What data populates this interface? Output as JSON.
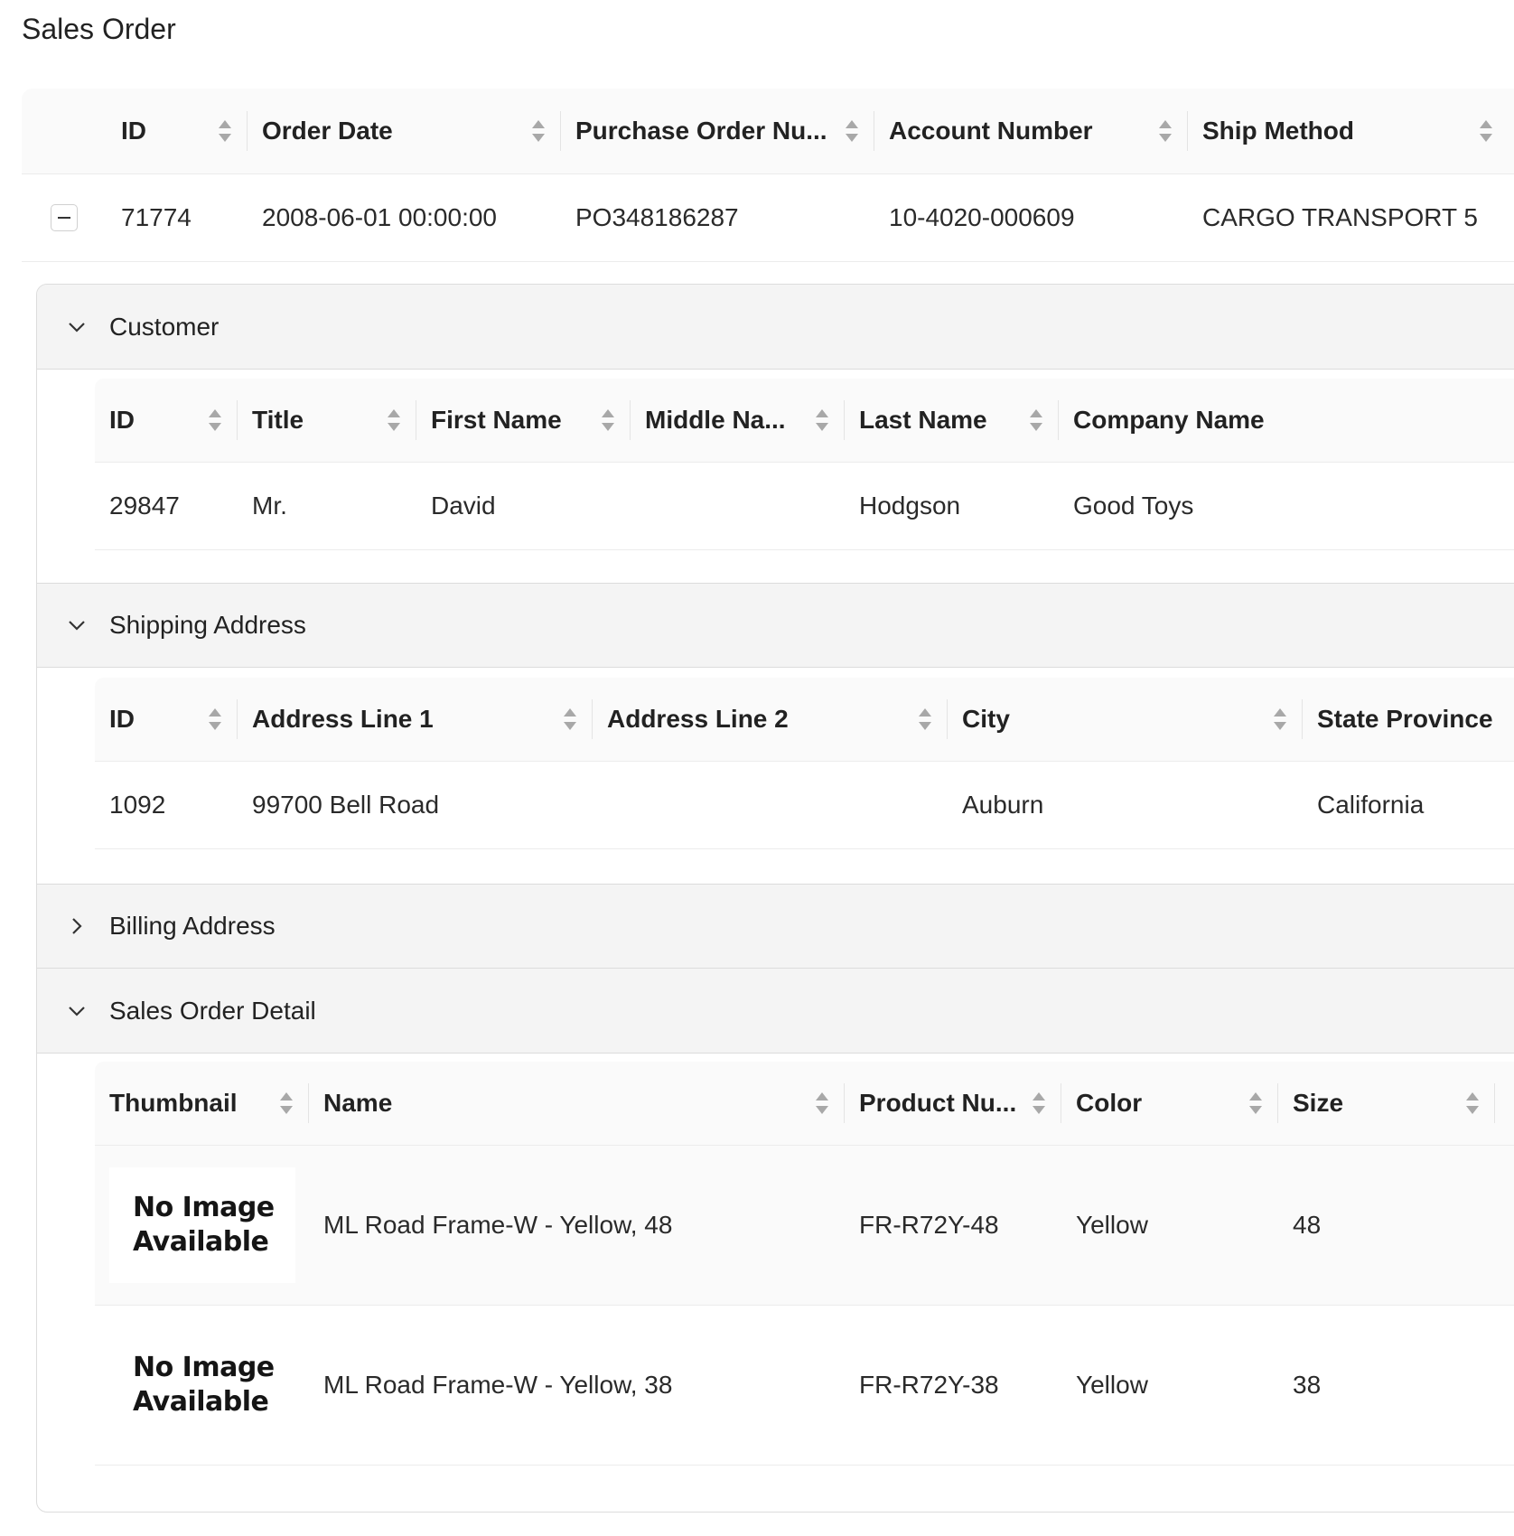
{
  "page": {
    "title": "Sales Order"
  },
  "orders": {
    "columns": [
      "ID",
      "Order Date",
      "Purchase Order Nu...",
      "Account Number",
      "Ship Method"
    ],
    "row": {
      "collapse_symbol": "−",
      "cells": [
        "71774",
        "2008-06-01 00:00:00",
        "PO348186287",
        "10-4020-000609",
        "CARGO TRANSPORT 5"
      ]
    }
  },
  "customer": {
    "title": "Customer",
    "columns": [
      "ID",
      "Title",
      "First Name",
      "Middle Na...",
      "Last Name",
      "Company Name"
    ],
    "row": [
      "29847",
      "Mr.",
      "David",
      "",
      "Hodgson",
      "Good Toys"
    ]
  },
  "shipping": {
    "title": "Shipping Address",
    "columns": [
      "ID",
      "Address Line 1",
      "Address Line 2",
      "City",
      "State Province"
    ],
    "row": [
      "1092",
      "99700 Bell Road",
      "",
      "Auburn",
      "California"
    ]
  },
  "billing": {
    "title": "Billing Address",
    "state": "collapsed"
  },
  "detail": {
    "title": "Sales Order Detail",
    "columns": [
      "Thumbnail",
      "Name",
      "Product Nu...",
      "Color",
      "Size"
    ],
    "rows": [
      {
        "thumb_line1": "No Image",
        "thumb_line2": "Available",
        "name": "ML Road Frame-W - Yellow, 48",
        "product": "FR-R72Y-48",
        "color": "Yellow",
        "size": "48"
      },
      {
        "thumb_line1": "No Image",
        "thumb_line2": "Available",
        "name": "ML Road Frame-W - Yellow, 38",
        "product": "FR-R72Y-38",
        "color": "Yellow",
        "size": "38"
      }
    ]
  },
  "colors": {
    "header_bg": "#fafafa",
    "section_bg": "#f4f4f4",
    "border": "#dcdcdc",
    "sorter": "#a8a8a8"
  },
  "icons": {
    "sort": "sort-icon",
    "expand": "chevron-down-icon",
    "collapsed": "chevron-right-icon",
    "row_collapse": "minus-icon"
  }
}
